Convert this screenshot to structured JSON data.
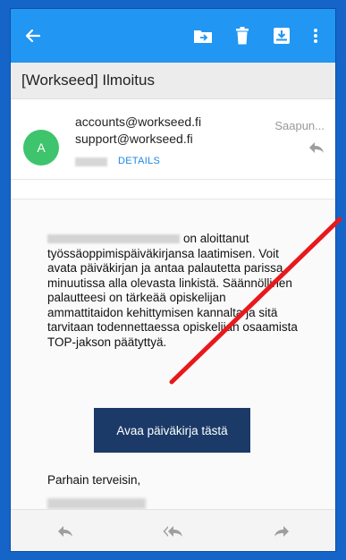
{
  "subject": "[Workseed] Ilmoitus",
  "sender": {
    "avatar_letter": "A",
    "from": "accounts@workseed.fi",
    "to": "support@workseed.fi",
    "details_label": "DETAILS",
    "arrived": "Saapun..."
  },
  "message": {
    "body_text": "on aloittanut työssäoppimispäiväkirjansa laatimisen. Voit avata päiväkirjan ja antaa palautetta parissa minuutissa alla olevasta linkistä. Säännöllinen palautteesi on tärkeää opiskelijan ammattitaidon kehittymisen kannalta ja sitä tarvitaan todennettaessa opiskelijan osaamista TOP-jakson päätyttyä.",
    "button_label": "Avaa päiväkirja tästä",
    "greeting": "Parhain terveisin,"
  },
  "colors": {
    "appbar": "#2196f3",
    "cta": "#1b3a68",
    "avatar": "#3ec46d",
    "annotation": "#e8191c"
  }
}
